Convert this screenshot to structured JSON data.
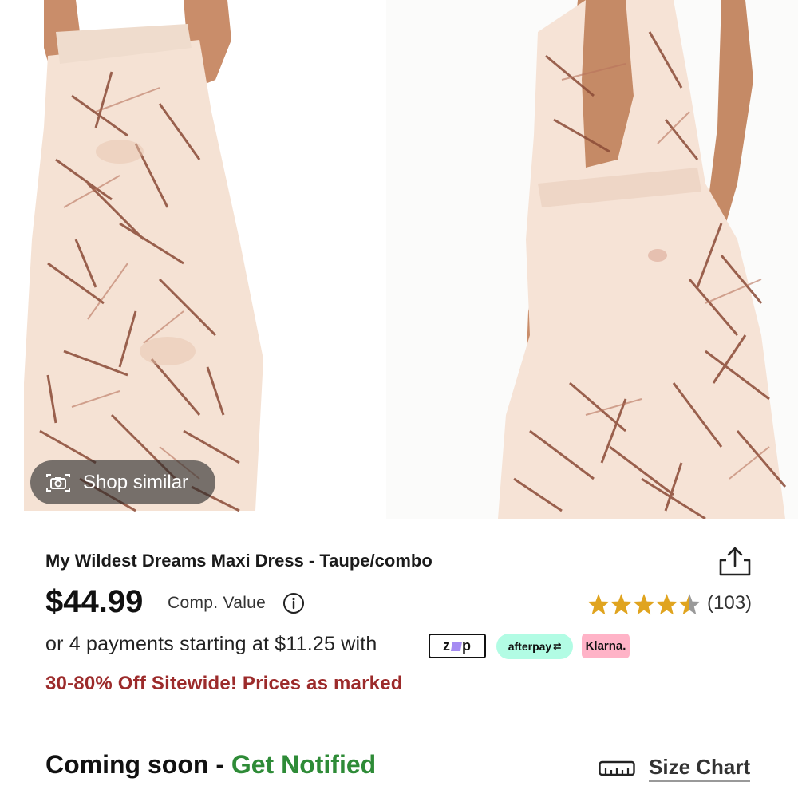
{
  "gallery": {
    "images": [
      "product-photo-back-view",
      "product-photo-side-view"
    ],
    "shop_similar_label": "Shop similar"
  },
  "product": {
    "title": "My Wildest Dreams Maxi Dress - Taupe/combo",
    "price": "$44.99",
    "comp_value_label": "Comp. Value",
    "rating": 4.5,
    "review_count": "(103)",
    "payments_text": "or 4 payments starting at $11.25 with",
    "payment_providers": {
      "zip": "zip",
      "afterpay": "afterpay",
      "klarna": "Klarna."
    },
    "promo": "30-80% Off Sitewide! Prices as marked"
  },
  "availability": {
    "status": "Coming soon",
    "separator": " - ",
    "notify_label": "Get Notified"
  },
  "size_chart_label": "Size Chart",
  "icons": [
    "camera-icon",
    "share-icon",
    "info-icon",
    "star-icon",
    "ruler-icon"
  ],
  "colors": {
    "promo": "#9c2b2b",
    "notify": "#2e8b37",
    "star": "#e0a41f",
    "afterpay_bg": "#b2fce4",
    "klarna_bg": "#ffb3c7",
    "dress_base": "#f6e3d6",
    "dress_print": "#8a4a36"
  }
}
